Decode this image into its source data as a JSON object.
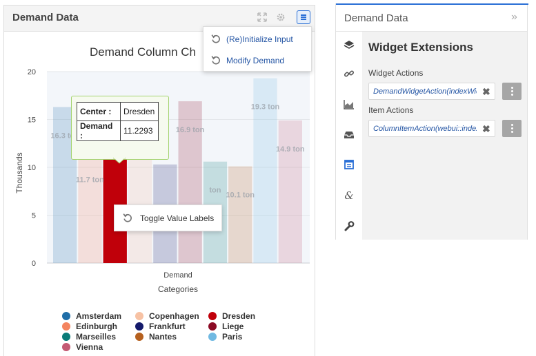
{
  "widget": {
    "title": "Demand Data",
    "menu": [
      {
        "label": "(Re)Initialize Input"
      },
      {
        "label": "Modify Demand"
      }
    ],
    "context_menu": {
      "label": "Toggle Value Labels"
    },
    "tooltip": {
      "rows": [
        {
          "key": "Center :",
          "value": "Dresden"
        },
        {
          "key": "Demand :",
          "value": "11.2293"
        }
      ]
    }
  },
  "chart_data": {
    "type": "bar",
    "title": "Demand Column Ch",
    "xlabel": "Categories",
    "ylabel": "Thousands",
    "categories": [
      "Demand"
    ],
    "ylim": [
      0,
      20
    ],
    "yticks": [
      "0",
      "5",
      "10",
      "15",
      "20"
    ],
    "grid": true,
    "legend_position": "bottom",
    "series": [
      {
        "name": "Amsterdam",
        "values": [
          16.3
        ],
        "label": "16.3 ton",
        "color": "#1f6ea8",
        "highlight": false
      },
      {
        "name": "Edinburgh",
        "values": [
          11.7
        ],
        "label": "11.7 ton",
        "color": "#f4845f",
        "highlight": false
      },
      {
        "name": "Dresden",
        "values": [
          11.2293
        ],
        "label": "",
        "color": "#c0000a",
        "highlight": true
      },
      {
        "name": "Copenhagen",
        "values": [
          16.3
        ],
        "label": "16.3 ton",
        "color": "#f7b89c",
        "highlight": false
      },
      {
        "name": "Frankfurt",
        "values": [
          10.3
        ],
        "label": "",
        "color": "#141a6b",
        "highlight": false
      },
      {
        "name": "Liege",
        "values": [
          16.9
        ],
        "label": "16.9 ton",
        "color": "#8b0a24",
        "highlight": false
      },
      {
        "name": "Marseilles",
        "values": [
          10.6
        ],
        "label": "ton",
        "color": "#0b7b78",
        "highlight": false
      },
      {
        "name": "Nantes",
        "values": [
          10.1
        ],
        "label": "10.1 ton",
        "color": "#b5601f",
        "highlight": false
      },
      {
        "name": "Paris",
        "values": [
          19.3
        ],
        "label": "19.3 ton",
        "color": "#70b9e2",
        "highlight": false
      },
      {
        "name": "Vienna",
        "values": [
          14.9
        ],
        "label": "14.9 ton",
        "color": "#c45a73",
        "highlight": false
      }
    ]
  },
  "legend": [
    {
      "name": "Amsterdam",
      "color": "#1f6ea8"
    },
    {
      "name": "Copenhagen",
      "color": "#f7c2a4"
    },
    {
      "name": "Dresden",
      "color": "#c0000a"
    },
    {
      "name": "Edinburgh",
      "color": "#f4845f"
    },
    {
      "name": "Frankfurt",
      "color": "#141a6b"
    },
    {
      "name": "Liege",
      "color": "#8b0a24"
    },
    {
      "name": "Marseilles",
      "color": "#0b7b78"
    },
    {
      "name": "Nantes",
      "color": "#b5601f"
    },
    {
      "name": "Paris",
      "color": "#70b9e2"
    },
    {
      "name": "Vienna",
      "color": "#c45a73"
    }
  ],
  "panel": {
    "title": "Demand Data",
    "collapse_icon": "double-chevron-right-icon",
    "section_title": "Widget Extensions",
    "widget_actions_label": "Widget Actions",
    "widget_action_value": "DemandWidgetAction(indexWidget::...)",
    "item_actions_label": "Item Actions",
    "item_action_value": "ColumnItemAction(webui::indexColumn...)",
    "nav_icons": [
      "layers-icon",
      "link-icon",
      "area-chart-icon",
      "inbox-icon",
      "widget-settings-icon",
      "ampersand-icon",
      "wrench-icon"
    ]
  },
  "colors": {
    "accent": "#2a6fd6",
    "link": "#2455a4"
  }
}
